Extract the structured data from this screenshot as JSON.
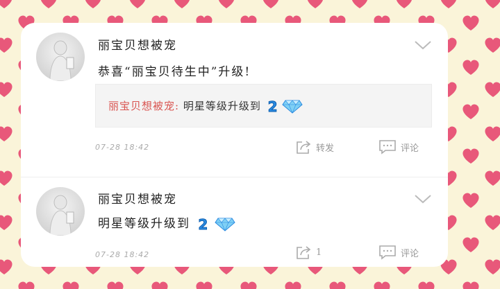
{
  "colors": {
    "background": "#faf4d9",
    "heart": "#e8587a",
    "card": "#ffffff",
    "repost_name": "#d9534f",
    "meta_text": "#aaaaaa"
  },
  "posts": [
    {
      "username": "丽宝贝想被宠",
      "content": "恭喜“丽宝贝待生中”升级!",
      "repost": {
        "name": "丽宝贝想被宠:",
        "text": " 明星等级升级到",
        "level": "2"
      },
      "time": "07-28 18:42",
      "repost_label": "转发",
      "comment_label": "评论"
    },
    {
      "username": "丽宝贝想被宠",
      "content": "明星等级升级到",
      "level": "2",
      "time": "07-28 18:42",
      "repost_label": "1",
      "comment_label": "评论"
    }
  ],
  "icons": {
    "menu": "chevron-down-icon",
    "repost": "repost-icon",
    "comment": "comment-icon",
    "diamond": "diamond-icon"
  }
}
